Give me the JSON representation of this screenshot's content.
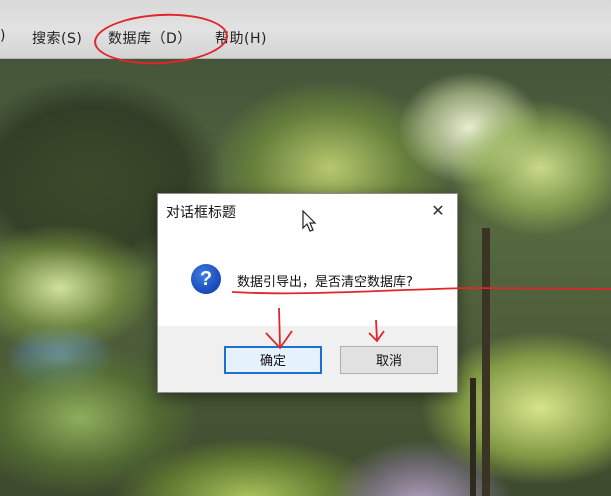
{
  "menubar": {
    "items": [
      {
        "label": "搜索(S)"
      },
      {
        "label": "数据库（D）"
      },
      {
        "label": "帮助(H)"
      }
    ],
    "truncated_left": ")"
  },
  "dialog": {
    "title": "对话框标题",
    "close_glyph": "✕",
    "icon": "question-icon",
    "icon_glyph": "?",
    "message": "数据引导出，是否清空数据库?",
    "buttons": {
      "ok_label": "确定",
      "cancel_label": "取消"
    }
  },
  "colors": {
    "annotation": "#e0262b",
    "default_button_border": "#1a6fd6",
    "icon_blue": "#1d4fbf"
  }
}
